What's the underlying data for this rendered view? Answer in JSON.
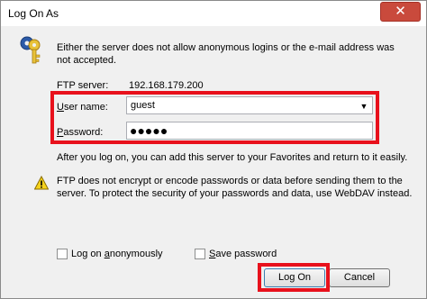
{
  "window": {
    "title": "Log On As",
    "close_glyph": "✕"
  },
  "dialog": {
    "message": "Either the server does not allow anonymous logins or the e-mail address was not accepted.",
    "server_label": "FTP server:",
    "server_value": "192.168.179.200",
    "user_label_accel": "U",
    "user_label_rest": "ser name:",
    "user_value": "guest",
    "password_label_accel": "P",
    "password_label_rest": "assword:",
    "password_mask": "●●●●●",
    "favorites_note": "After you log on, you can add this server to your Favorites and return to it easily.",
    "security_warning": "FTP does not encrypt or encode passwords or data before sending them to the server.  To protect the security of your passwords and data, use WebDAV instead.",
    "anon_label_prefix": "Log on ",
    "anon_label_accel": "a",
    "anon_label_rest": "nonymously",
    "anon_checked": false,
    "save_label_accel": "S",
    "save_label_rest": "ave password",
    "save_checked": false,
    "logon_button": "Log On",
    "cancel_button": "Cancel"
  },
  "icons": {
    "key": "key-icon",
    "warning": "warning-icon",
    "dropdown": "chevron-down-icon"
  },
  "colors": {
    "highlight": "#e8111c",
    "close_button": "#c94a3c"
  }
}
